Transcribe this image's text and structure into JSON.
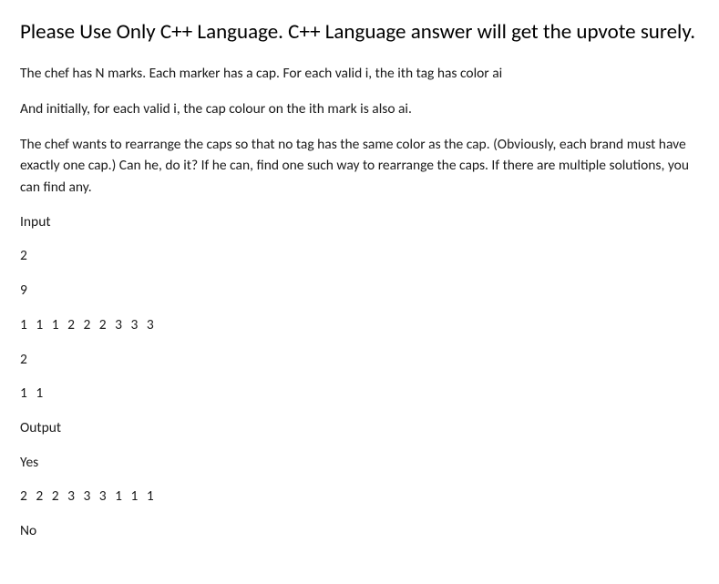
{
  "title": "Please Use Only C++ Language. C++ Language answer will get the upvote surely.",
  "problem": {
    "p1": "The chef has N marks. Each marker has a cap. For each valid i, the ith tag has color ai",
    "p2": "And initially, for each valid i, the cap colour on the ith mark is also ai.",
    "p3": "The chef wants to rearrange the caps so that no tag has the same color as the cap. (Obviously, each brand must have exactly one cap.) Can he, do it? If he can, find one such way to rearrange the caps. If there are multiple solutions, you can find any."
  },
  "io": {
    "input_label": "Input",
    "input_lines": [
      "2",
      "9",
      "1 1 1 2 2 2 3 3 3",
      "2",
      "1 1"
    ],
    "output_label": "Output",
    "output_lines": [
      "Yes",
      "2 2 2 3 3 3 1 1 1",
      "No"
    ]
  }
}
